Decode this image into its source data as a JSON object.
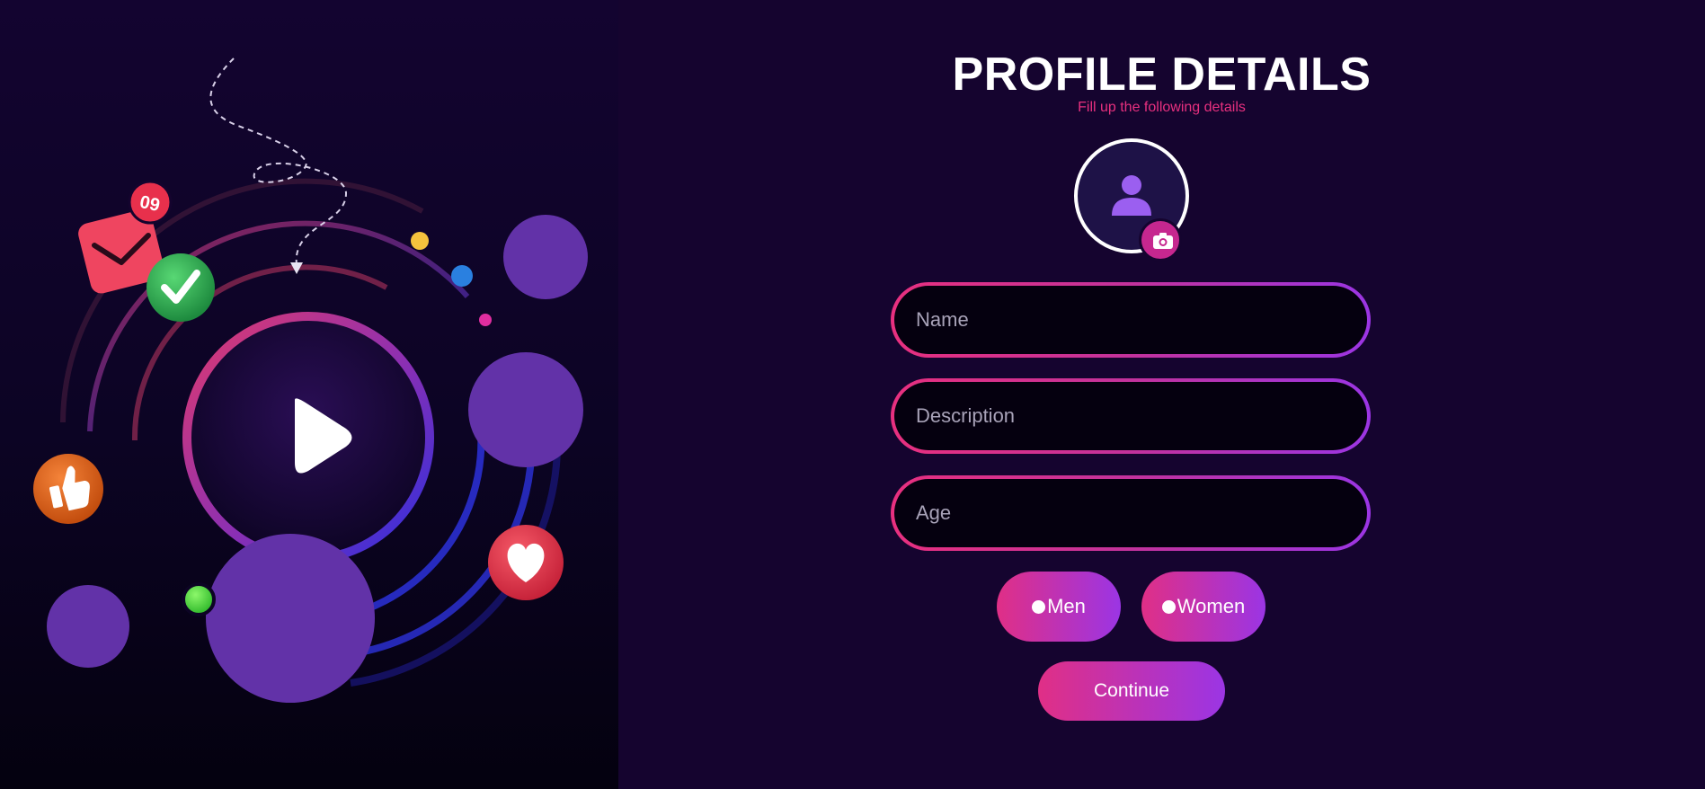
{
  "illustration": {
    "notification_badge": "09",
    "colors": {
      "purple_bubble": "#6232a8",
      "mail_red": "#ef4560",
      "check_green": "#33b456",
      "like_orange": "#e86a1e",
      "heart_red": "#e8384c",
      "ring_blue": "#3a2fd0",
      "ring_pink": "#d0306a"
    },
    "icons": [
      "play-icon",
      "mail-icon",
      "check-icon",
      "thumbs-up-icon",
      "heart-icon"
    ]
  },
  "form": {
    "title": "PROFILE DETAILS",
    "subtitle": "Fill up the following details",
    "avatar_icon": "user-icon",
    "camera_icon": "camera-icon",
    "fields": {
      "name_placeholder": "Name",
      "name_value": "",
      "description_placeholder": "Description",
      "description_value": "",
      "age_placeholder": "Age",
      "age_value": ""
    },
    "gender": {
      "men_label": "Men",
      "women_label": "Women"
    },
    "continue_label": "Continue",
    "colors": {
      "accent_pink": "#e02f86",
      "accent_purple": "#9b35e4",
      "subtitle_pink": "#e8307f",
      "background": "#15042f"
    }
  }
}
